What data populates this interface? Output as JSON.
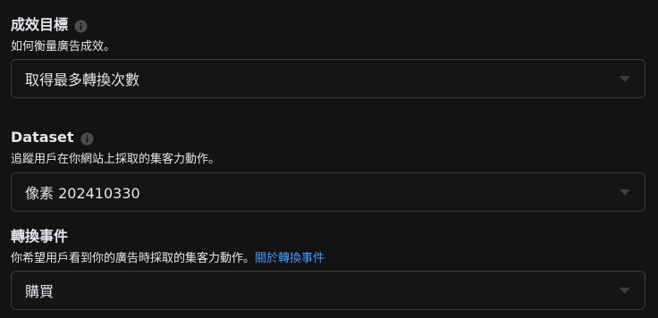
{
  "goal": {
    "title": "成效目標",
    "info_icon": "info-icon",
    "description": "如何衡量廣告成效。",
    "selected": "取得最多轉換次數"
  },
  "dataset": {
    "title": "Dataset",
    "info_icon": "info-icon",
    "description": "追蹤用戶在你網站上採取的集客力動作。",
    "selected": "像素 202410330"
  },
  "conversion_event": {
    "title": "轉換事件",
    "description": "你希望用戶看到你的廣告時採取的集客力動作。",
    "link_text": "關於轉換事件",
    "selected": "購買"
  },
  "colors": {
    "background": "#131313",
    "text": "#e4e6eb",
    "link": "#4599ff",
    "border": "#3a3b3c",
    "caret": "#3c3d3f"
  }
}
